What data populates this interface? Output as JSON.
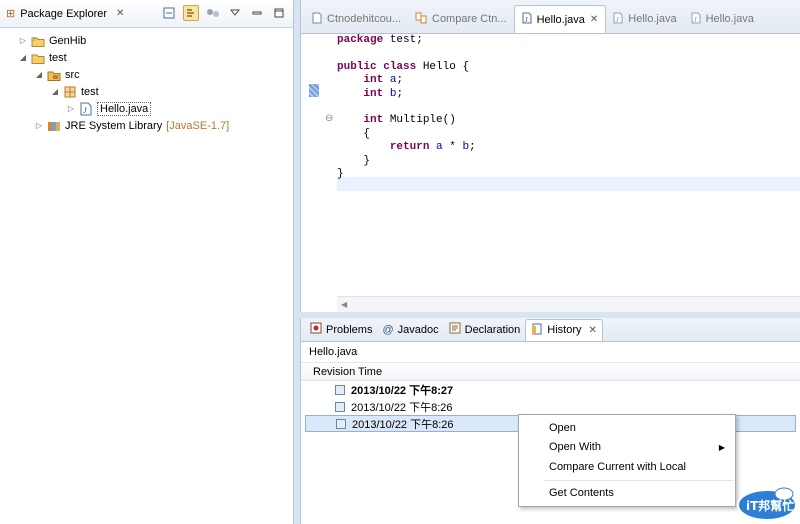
{
  "explorer": {
    "tab_label": "Package Explorer",
    "close_glyph": "✕",
    "tree": [
      {
        "label": "GenHib",
        "suffix": "",
        "icon": "project-icon",
        "twisty": "▷"
      },
      {
        "label": "test",
        "suffix": "",
        "icon": "project-icon",
        "twisty": "◢"
      },
      {
        "label": "src",
        "suffix": "",
        "icon": "source-folder-icon",
        "twisty": "◢"
      },
      {
        "label": "test",
        "suffix": "",
        "icon": "package-icon",
        "twisty": "◢"
      },
      {
        "label": "Hello.java",
        "suffix": "",
        "icon": "java-file-icon",
        "twisty": "▷"
      },
      {
        "label": "JRE System Library",
        "suffix": "[JavaSE-1.7]",
        "icon": "library-icon",
        "twisty": "▷"
      }
    ]
  },
  "editor": {
    "tabs": [
      {
        "label": "Ctnodehitcou...",
        "icon": "file-icon"
      },
      {
        "label": "Compare Ctn...",
        "icon": "compare-icon"
      },
      {
        "label": "Hello.java",
        "icon": "java-file-icon",
        "active": true
      },
      {
        "label": "Hello.java",
        "icon": "java-file-icon"
      },
      {
        "label": "Hello.java",
        "icon": "java-file-icon"
      }
    ],
    "code": {
      "l1_kw": "package",
      "l1_rest": " test;",
      "l3_kw1": "public",
      "l3_kw2": "class",
      "l3_rest": " Hello {",
      "l4_kw": "int",
      "l4_fld": "a",
      "l4_end": ";",
      "l5_kw": "int",
      "l5_fld": "b",
      "l5_end": ";",
      "l7_kw": "int",
      "l7_rest": " Multiple()",
      "l8": "{",
      "l9_kw": "return",
      "l9_fld1": "a",
      "l9_mid": " * ",
      "l9_fld2": "b",
      "l9_end": ";",
      "l10": "}",
      "l11": "}"
    }
  },
  "bottom": {
    "tabs": [
      {
        "label": "Problems",
        "icon": "problems-icon"
      },
      {
        "label": "Javadoc",
        "icon": "at-icon"
      },
      {
        "label": "Declaration",
        "icon": "declaration-icon"
      },
      {
        "label": "History",
        "icon": "history-icon",
        "active": true
      }
    ],
    "history_file": "Hello.java",
    "column_header": "Revision Time",
    "revisions": [
      {
        "time": "2013/10/22 下午8:27",
        "bold": true
      },
      {
        "time": "2013/10/22 下午8:26",
        "bold": false
      },
      {
        "time": "2013/10/22 下午8:26",
        "bold": false,
        "selected": true
      }
    ]
  },
  "context_menu": {
    "items": [
      "Open",
      "Open With",
      "Compare Current with Local"
    ],
    "submenu_arrow": "▶",
    "after_separator": "Get Contents"
  },
  "watermark": {
    "text": "iT邦幫忙"
  },
  "colors": {
    "keyword": "#7f0055",
    "field": "#0000c0",
    "selection": "#dbe8f9"
  }
}
